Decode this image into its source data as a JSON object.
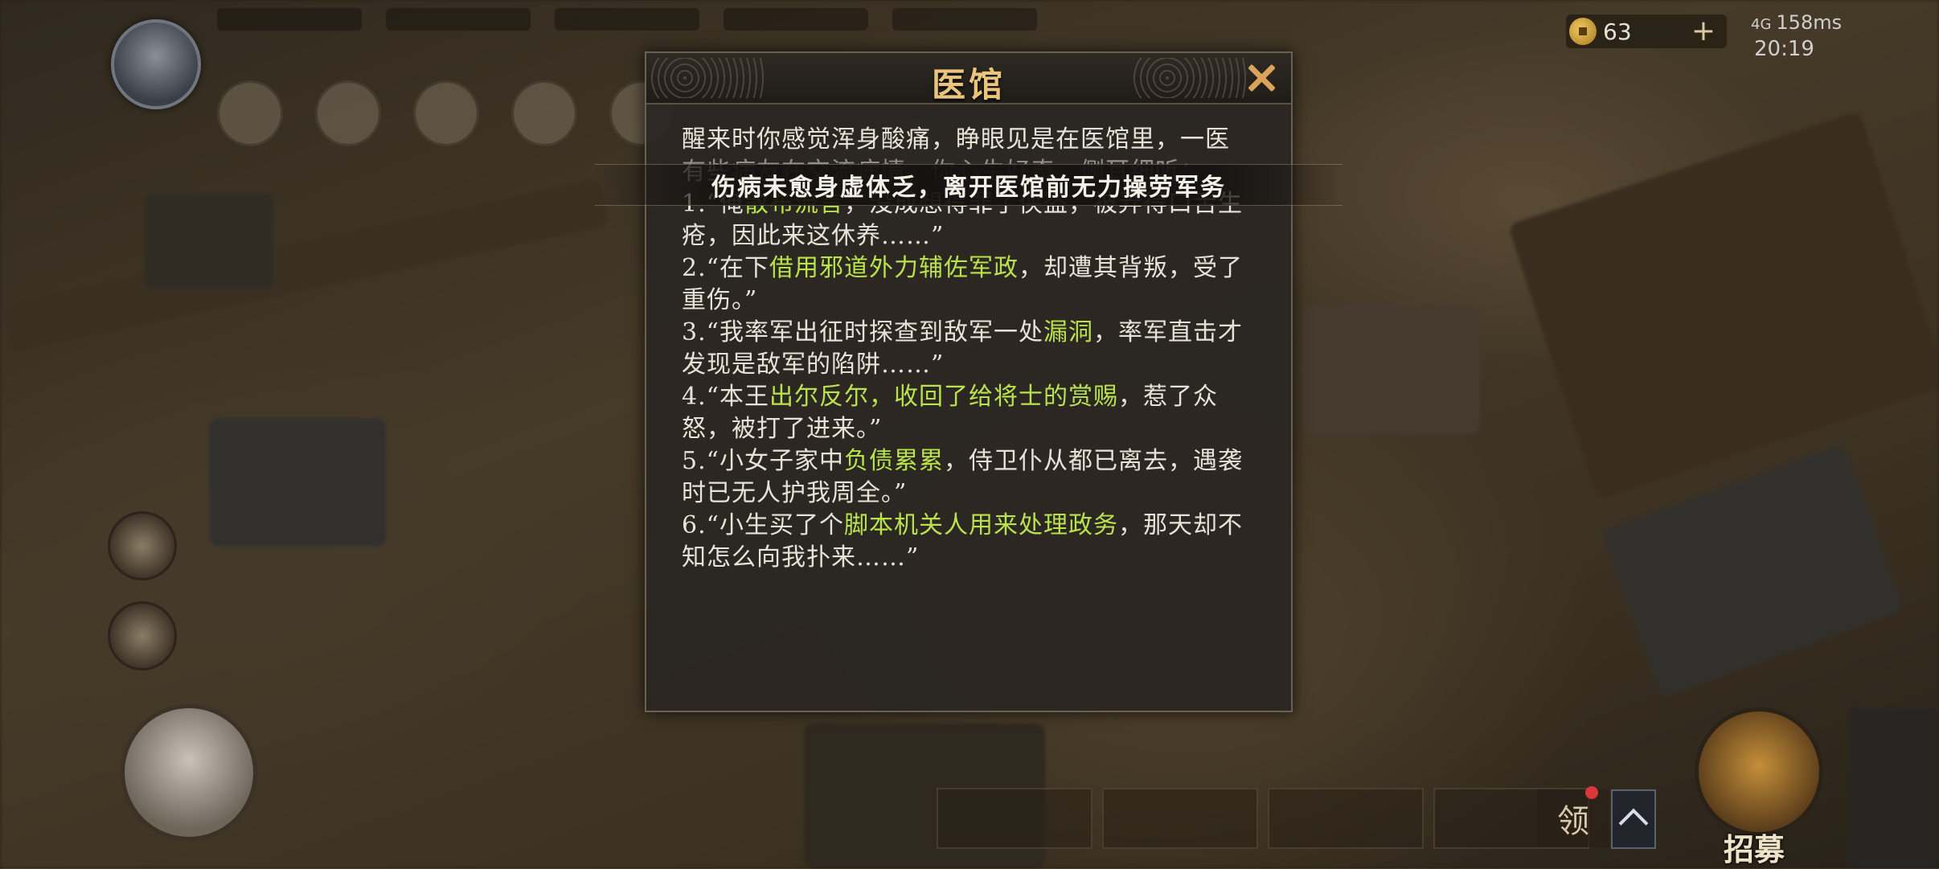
{
  "status_bar": {
    "network": "4G",
    "latency": "158ms",
    "time": "20:19"
  },
  "currency": {
    "gold": "63",
    "add_label": "+"
  },
  "modal": {
    "title": "医馆",
    "intro": "醒来时你感觉浑身酸痛，睁眼见是在医馆里，一医",
    "intro_obscured": "有些病友在交流病情，你心生好奇，侧耳细听：",
    "stories": [
      {
        "prefix": "1.“俺",
        "highlight": "散布流言",
        "suffix": "，没成想得罪了侠盗，被弄得口舌生疮，因此来这休养……”"
      },
      {
        "prefix": "2.“在下",
        "highlight": "借用邪道外力辅佐军政",
        "suffix": "，却遭其背叛，受了重伤。”"
      },
      {
        "prefix": "3.“我率军出征时探查到敌军一处",
        "highlight": "漏洞",
        "suffix": "，率军直击才发现是敌军的陷阱……”"
      },
      {
        "prefix": "4.“本王",
        "highlight": "出尔反尔，收回了给将士的赏赐",
        "suffix": "，惹了众怒，被打了进来。”"
      },
      {
        "prefix": "5.“小女子家中",
        "highlight": "负债累累",
        "suffix": "，侍卫仆从都已离去，遇袭时已无人护我周全。”"
      },
      {
        "prefix": "6.“小生买了个",
        "highlight": "脚本机关人用来处理政务",
        "suffix": "，那天却不知怎么向我扑来……”"
      }
    ]
  },
  "toast": "伤病未愈身虚体乏，离开医馆前无力操劳军务",
  "bottom": {
    "collect_label": "领",
    "recruit_label": "招募"
  },
  "colors": {
    "highlight": "#b9e34a",
    "title": "#e9c47c",
    "close": "#d9a45a"
  }
}
